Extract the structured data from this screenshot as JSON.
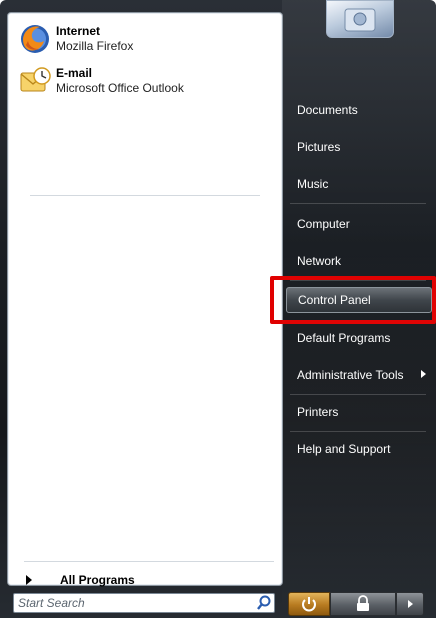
{
  "pinned": [
    {
      "title": "Internet",
      "subtitle": "Mozilla Firefox",
      "icon": "firefox-icon"
    },
    {
      "title": "E-mail",
      "subtitle": "Microsoft Office Outlook",
      "icon": "outlook-icon"
    }
  ],
  "all_programs_label": "All Programs",
  "search": {
    "placeholder": "Start Search"
  },
  "right_links": [
    {
      "label": "Documents"
    },
    {
      "label": "Pictures"
    },
    {
      "label": "Music"
    },
    {
      "label": "Computer"
    },
    {
      "label": "Network"
    },
    {
      "label": "Control Panel"
    },
    {
      "label": "Default Programs"
    },
    {
      "label": "Administrative Tools"
    },
    {
      "label": "Printers"
    },
    {
      "label": "Help and Support"
    }
  ],
  "colors": {
    "highlight_frame": "#e00000",
    "menu_background": "#1b1f24",
    "power_button": "#c98a2b"
  },
  "icons": {
    "search": "search-icon",
    "power": "power-icon",
    "lock": "lock-icon",
    "more": "arrow-right-icon",
    "user": "user-picture"
  }
}
